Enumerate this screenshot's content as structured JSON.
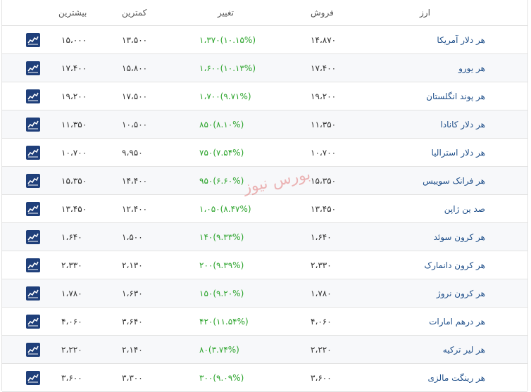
{
  "header": {
    "currency": "ارز",
    "sell": "فروش",
    "change": "تغییر",
    "low": "کمترین",
    "high": "بیشترین"
  },
  "rows": [
    {
      "name": "هر دلار آمریکا",
      "sell": "۱۴،۸۷۰",
      "change": "۱،۳۷۰(۱۰.۱۵%)",
      "low": "۱۳،۵۰۰",
      "high": "۱۵،۰۰۰"
    },
    {
      "name": "هر یورو",
      "sell": "۱۷،۴۰۰",
      "change": "۱،۶۰۰(۱۰.۱۳%)",
      "low": "۱۵،۸۰۰",
      "high": "۱۷،۴۰۰"
    },
    {
      "name": "هر پوند انگلستان",
      "sell": "۱۹،۲۰۰",
      "change": "۱،۷۰۰(۹.۷۱%)",
      "low": "۱۷،۵۰۰",
      "high": "۱۹،۲۰۰"
    },
    {
      "name": "هر دلار کانادا",
      "sell": "۱۱،۳۵۰",
      "change": "۸۵۰(۸.۱۰%)",
      "low": "۱۰،۵۰۰",
      "high": "۱۱،۳۵۰"
    },
    {
      "name": "هر دلار استرالیا",
      "sell": "۱۰،۷۰۰",
      "change": "۷۵۰(۷.۵۴%)",
      "low": "۹،۹۵۰",
      "high": "۱۰،۷۰۰"
    },
    {
      "name": "هر فرانک سوییس",
      "sell": "۱۵،۳۵۰",
      "change": "۹۵۰(۶.۶۰%)",
      "low": "۱۴،۴۰۰",
      "high": "۱۵،۳۵۰"
    },
    {
      "name": "صد ین ژاپن",
      "sell": "۱۳،۴۵۰",
      "change": "۱،۰۵۰(۸.۴۷%)",
      "low": "۱۲،۴۰۰",
      "high": "۱۳،۴۵۰"
    },
    {
      "name": "هر کرون سوئد",
      "sell": "۱،۶۴۰",
      "change": "۱۴۰(۹.۳۳%)",
      "low": "۱،۵۰۰",
      "high": "۱،۶۴۰"
    },
    {
      "name": "هر کرون دانمارک",
      "sell": "۲،۳۳۰",
      "change": "۲۰۰(۹.۳۹%)",
      "low": "۲،۱۳۰",
      "high": "۲،۳۳۰"
    },
    {
      "name": "هر کرون نروژ",
      "sell": "۱،۷۸۰",
      "change": "۱۵۰(۹.۲۰%)",
      "low": "۱،۶۳۰",
      "high": "۱،۷۸۰"
    },
    {
      "name": "هر درهم امارات",
      "sell": "۴،۰۶۰",
      "change": "۴۲۰(۱۱.۵۴%)",
      "low": "۳،۶۴۰",
      "high": "۴،۰۶۰"
    },
    {
      "name": "هر لیر ترکیه",
      "sell": "۲،۲۲۰",
      "change": "۸۰(۳.۷۴%)",
      "low": "۲،۱۴۰",
      "high": "۲،۲۲۰"
    },
    {
      "name": "هر رینگت مالزی",
      "sell": "۳،۶۰۰",
      "change": "۳۰۰(۹.۰۹%)",
      "low": "۳،۳۰۰",
      "high": "۳،۶۰۰"
    }
  ],
  "watermark": "بورس نیوز",
  "colors": {
    "link": "#1f4f8a",
    "positive": "#2fa52f",
    "chart_button": "#1f3f7a"
  },
  "icons": {
    "row_chart": "line-chart-icon"
  }
}
